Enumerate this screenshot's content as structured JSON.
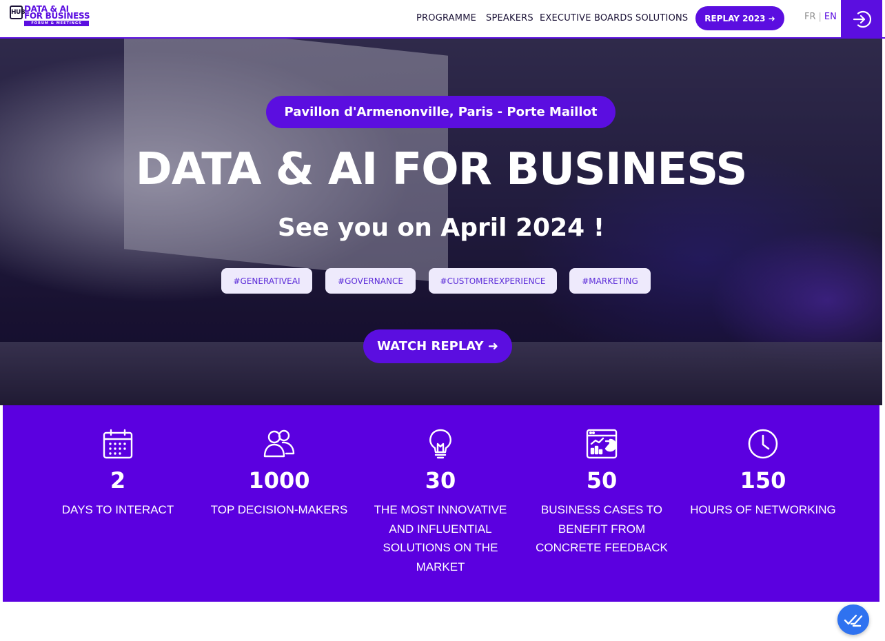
{
  "header": {
    "logo": {
      "hub": "HUB",
      "line1": "DATA & AI",
      "line2": "FOR BUSINESS",
      "strip": "FORUM & MEETINGS"
    },
    "nav": [
      "PROGRAMME",
      "SPEAKERS",
      "EXECUTIVE BOARDS",
      "SOLUTIONS"
    ],
    "replay_button": "REPLAY 2023 ➜",
    "lang": {
      "fr": "FR",
      "sep": "|",
      "en": "EN",
      "active": "EN"
    },
    "login_icon": "sign-in-icon"
  },
  "hero": {
    "location": "Pavillon d'Armenonville, Paris - Porte Maillot",
    "title": "DATA & AI FOR BUSINESS",
    "subtitle": "See you on April  2024 !",
    "tags": [
      "#GENERATIVEAI",
      "#GOVERNANCE",
      "#CUSTOMEREXPERIENCE",
      "#MARKETING"
    ],
    "cta": "WATCH REPLAY ➜"
  },
  "stats": [
    {
      "icon": "calendar-icon",
      "value": "2",
      "label": "DAYS TO INTERACT"
    },
    {
      "icon": "users-icon",
      "value": "1000",
      "label": "TOP DECISION-MAKERS"
    },
    {
      "icon": "lightbulb-icon",
      "value": "30",
      "label": "THE MOST INNOVATIVE AND INFLUENTIAL SOLUTIONS ON THE MARKET"
    },
    {
      "icon": "dashboard-icon",
      "value": "50",
      "label": "BUSINESS CASES TO BENEFIT FROM CONCRETE FEEDBACK"
    },
    {
      "icon": "clock-icon",
      "value": "150",
      "label": "HOURS OF NETWORKING"
    }
  ],
  "chat_icon": "chat-checkmark-icon",
  "colors": {
    "accent": "#5b0ee0",
    "stats_bg": "#5b00e0",
    "tag_bg": "#eeeafc",
    "chat": "#2f72f0"
  }
}
